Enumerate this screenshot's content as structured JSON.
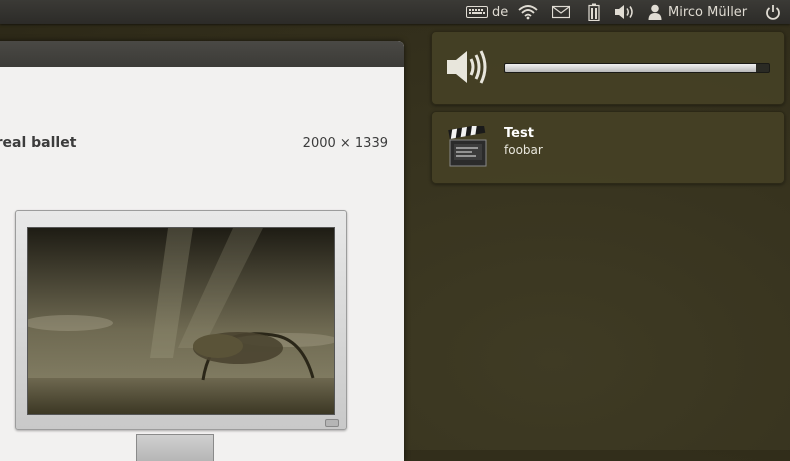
{
  "panel": {
    "keyboard_layout": "de",
    "user_name": "Mirco Müller",
    "icons": [
      "keyboard-icon",
      "wifi-icon",
      "mail-icon",
      "battery-icon",
      "volume-icon",
      "user-icon",
      "power-icon"
    ]
  },
  "window": {
    "wallpaper_name": "poreal ballet",
    "wallpaper_size": "2000 × 1339"
  },
  "volume_osd": {
    "icon": "speaker-volume-icon",
    "level": 0.95
  },
  "notification": {
    "icon": "clapperboard-icon",
    "title": "Test",
    "body": "foobar"
  },
  "colors": {
    "desktop_bg": "#35311d",
    "bubble_bg": "#46422a",
    "panel_bg": "#2c2b28"
  }
}
